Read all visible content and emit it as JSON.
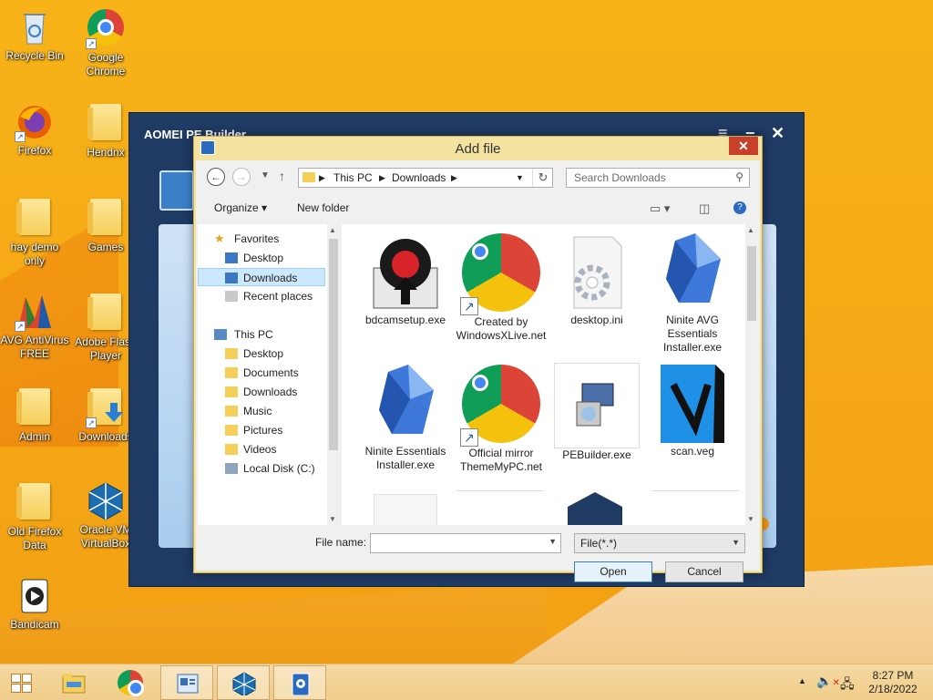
{
  "desktop": {
    "icons": [
      {
        "label": "Recycle Bin"
      },
      {
        "label": "Google Chrome"
      },
      {
        "label": "Firefox"
      },
      {
        "label": "Hendnx"
      },
      {
        "label": "hay demo only"
      },
      {
        "label": "Games"
      },
      {
        "label": "AVG AntiVirus FREE"
      },
      {
        "label": "Adobe Flash Player"
      },
      {
        "label": "Admin"
      },
      {
        "label": "Downloads"
      },
      {
        "label": "Old Firefox Data"
      },
      {
        "label": "Oracle VM VirtualBox"
      },
      {
        "label": "Bandicam"
      }
    ]
  },
  "aomei": {
    "title": "AOMEI PE Builder",
    "close_glyph": "✕",
    "menu_glyph": "≡",
    "min_glyph": "−"
  },
  "dialog": {
    "title": "Add file",
    "close_glyph": "✕",
    "address": {
      "segment1": "This PC",
      "segment2": "Downloads"
    },
    "search_placeholder": "Search Downloads",
    "toolbar": {
      "organize": "Organize",
      "new_folder": "New folder"
    },
    "nav": {
      "favorites": "Favorites",
      "fav_items": [
        "Desktop",
        "Downloads",
        "Recent places"
      ],
      "this_pc": "This PC",
      "pc_items": [
        "Desktop",
        "Documents",
        "Downloads",
        "Music",
        "Pictures",
        "Videos",
        "Local Disk (C:)"
      ]
    },
    "files": [
      {
        "name": "bdcamsetup.exe"
      },
      {
        "name": "Created by WindowsXLive.net"
      },
      {
        "name": "desktop.ini"
      },
      {
        "name": "Ninite AVG Essentials Installer.exe"
      },
      {
        "name": "Ninite Essentials Installer.exe"
      },
      {
        "name": "Official mirror ThemeMyPC.net"
      },
      {
        "name": "PEBuilder.exe"
      },
      {
        "name": "scan.veg"
      }
    ],
    "file_name_label": "File name:",
    "file_name_value": "",
    "file_type": "File(*.*)",
    "open_label": "Open",
    "cancel_label": "Cancel"
  },
  "taskbar": {
    "time": "8:27 PM",
    "date": "2/18/2022"
  },
  "colors": {
    "wallpaper": "#f5a716",
    "aomei_bg": "#1f3a63",
    "dialog_frame": "#f4e3a0",
    "close_red": "#c7402a",
    "selection": "#cce8ff"
  }
}
